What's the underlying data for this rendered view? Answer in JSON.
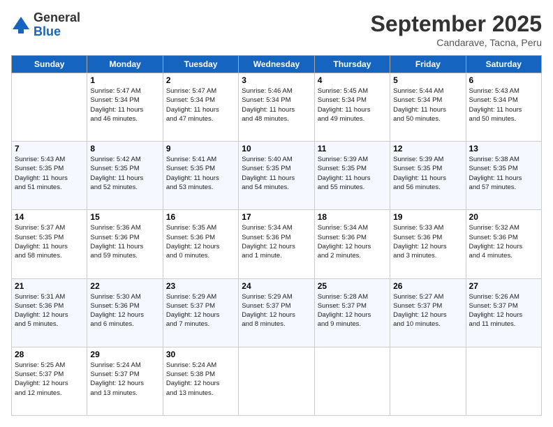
{
  "header": {
    "logo_general": "General",
    "logo_blue": "Blue",
    "month_title": "September 2025",
    "location": "Candarave, Tacna, Peru"
  },
  "days_of_week": [
    "Sunday",
    "Monday",
    "Tuesday",
    "Wednesday",
    "Thursday",
    "Friday",
    "Saturday"
  ],
  "weeks": [
    [
      {
        "day": "",
        "info": ""
      },
      {
        "day": "1",
        "info": "Sunrise: 5:47 AM\nSunset: 5:34 PM\nDaylight: 11 hours\nand 46 minutes."
      },
      {
        "day": "2",
        "info": "Sunrise: 5:47 AM\nSunset: 5:34 PM\nDaylight: 11 hours\nand 47 minutes."
      },
      {
        "day": "3",
        "info": "Sunrise: 5:46 AM\nSunset: 5:34 PM\nDaylight: 11 hours\nand 48 minutes."
      },
      {
        "day": "4",
        "info": "Sunrise: 5:45 AM\nSunset: 5:34 PM\nDaylight: 11 hours\nand 49 minutes."
      },
      {
        "day": "5",
        "info": "Sunrise: 5:44 AM\nSunset: 5:34 PM\nDaylight: 11 hours\nand 50 minutes."
      },
      {
        "day": "6",
        "info": "Sunrise: 5:43 AM\nSunset: 5:34 PM\nDaylight: 11 hours\nand 50 minutes."
      }
    ],
    [
      {
        "day": "7",
        "info": "Sunrise: 5:43 AM\nSunset: 5:35 PM\nDaylight: 11 hours\nand 51 minutes."
      },
      {
        "day": "8",
        "info": "Sunrise: 5:42 AM\nSunset: 5:35 PM\nDaylight: 11 hours\nand 52 minutes."
      },
      {
        "day": "9",
        "info": "Sunrise: 5:41 AM\nSunset: 5:35 PM\nDaylight: 11 hours\nand 53 minutes."
      },
      {
        "day": "10",
        "info": "Sunrise: 5:40 AM\nSunset: 5:35 PM\nDaylight: 11 hours\nand 54 minutes."
      },
      {
        "day": "11",
        "info": "Sunrise: 5:39 AM\nSunset: 5:35 PM\nDaylight: 11 hours\nand 55 minutes."
      },
      {
        "day": "12",
        "info": "Sunrise: 5:39 AM\nSunset: 5:35 PM\nDaylight: 11 hours\nand 56 minutes."
      },
      {
        "day": "13",
        "info": "Sunrise: 5:38 AM\nSunset: 5:35 PM\nDaylight: 11 hours\nand 57 minutes."
      }
    ],
    [
      {
        "day": "14",
        "info": "Sunrise: 5:37 AM\nSunset: 5:35 PM\nDaylight: 11 hours\nand 58 minutes."
      },
      {
        "day": "15",
        "info": "Sunrise: 5:36 AM\nSunset: 5:36 PM\nDaylight: 11 hours\nand 59 minutes."
      },
      {
        "day": "16",
        "info": "Sunrise: 5:35 AM\nSunset: 5:36 PM\nDaylight: 12 hours\nand 0 minutes."
      },
      {
        "day": "17",
        "info": "Sunrise: 5:34 AM\nSunset: 5:36 PM\nDaylight: 12 hours\nand 1 minute."
      },
      {
        "day": "18",
        "info": "Sunrise: 5:34 AM\nSunset: 5:36 PM\nDaylight: 12 hours\nand 2 minutes."
      },
      {
        "day": "19",
        "info": "Sunrise: 5:33 AM\nSunset: 5:36 PM\nDaylight: 12 hours\nand 3 minutes."
      },
      {
        "day": "20",
        "info": "Sunrise: 5:32 AM\nSunset: 5:36 PM\nDaylight: 12 hours\nand 4 minutes."
      }
    ],
    [
      {
        "day": "21",
        "info": "Sunrise: 5:31 AM\nSunset: 5:36 PM\nDaylight: 12 hours\nand 5 minutes."
      },
      {
        "day": "22",
        "info": "Sunrise: 5:30 AM\nSunset: 5:36 PM\nDaylight: 12 hours\nand 6 minutes."
      },
      {
        "day": "23",
        "info": "Sunrise: 5:29 AM\nSunset: 5:37 PM\nDaylight: 12 hours\nand 7 minutes."
      },
      {
        "day": "24",
        "info": "Sunrise: 5:29 AM\nSunset: 5:37 PM\nDaylight: 12 hours\nand 8 minutes."
      },
      {
        "day": "25",
        "info": "Sunrise: 5:28 AM\nSunset: 5:37 PM\nDaylight: 12 hours\nand 9 minutes."
      },
      {
        "day": "26",
        "info": "Sunrise: 5:27 AM\nSunset: 5:37 PM\nDaylight: 12 hours\nand 10 minutes."
      },
      {
        "day": "27",
        "info": "Sunrise: 5:26 AM\nSunset: 5:37 PM\nDaylight: 12 hours\nand 11 minutes."
      }
    ],
    [
      {
        "day": "28",
        "info": "Sunrise: 5:25 AM\nSunset: 5:37 PM\nDaylight: 12 hours\nand 12 minutes."
      },
      {
        "day": "29",
        "info": "Sunrise: 5:24 AM\nSunset: 5:37 PM\nDaylight: 12 hours\nand 13 minutes."
      },
      {
        "day": "30",
        "info": "Sunrise: 5:24 AM\nSunset: 5:38 PM\nDaylight: 12 hours\nand 13 minutes."
      },
      {
        "day": "",
        "info": ""
      },
      {
        "day": "",
        "info": ""
      },
      {
        "day": "",
        "info": ""
      },
      {
        "day": "",
        "info": ""
      }
    ]
  ]
}
